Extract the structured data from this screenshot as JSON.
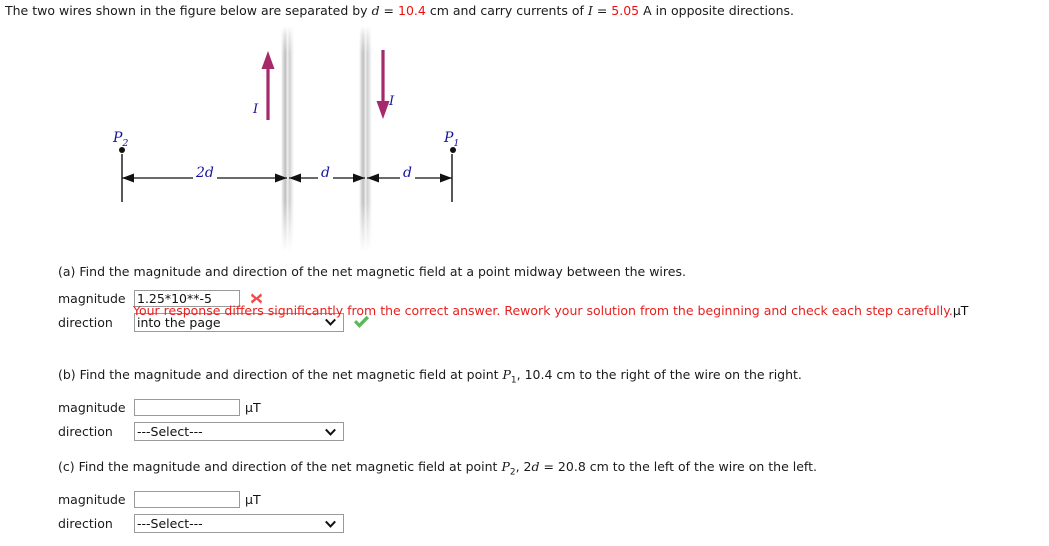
{
  "problem": {
    "intro_pre": "The two wires shown in the figure below are separated by ",
    "intro_d_sym": "d",
    "intro_eq1": " = ",
    "intro_d_value": "10.4",
    "intro_mid": " cm and carry currents of ",
    "intro_i_sym": "I",
    "intro_eq2": " = ",
    "intro_i_value": "5.05",
    "intro_post": " A in opposite directions."
  },
  "figure": {
    "current_label_left": "I",
    "current_label_right": "I",
    "point_left_label": "P",
    "point_left_sub": "2",
    "point_right_label": "P",
    "point_right_sub": "1",
    "dim_label_left": "2d",
    "dim_label_middle": "d",
    "dim_label_right": "d",
    "arrow_color": "#a6296b",
    "label_color": "#15139c"
  },
  "parts": {
    "a": {
      "prompt_prefix": "(a) Find the magnitude and direction of the net magnetic field at a point midway between the wires.",
      "magnitude_label": "magnitude",
      "magnitude_value": "1.25*10**-5",
      "magnitude_placeholder": "",
      "magnitude_mark": "incorrect-x",
      "feedback_text": "Your response differs significantly from the correct answer. Rework your solution from the beginning and check each step carefully.",
      "feedback_unit": "µT",
      "direction_label": "direction",
      "direction_value": "into the page",
      "direction_mark": "correct-check"
    },
    "b": {
      "prompt_a": "(b) Find the magnitude and direction of the net magnetic field at point ",
      "prompt_sym": "P",
      "prompt_sub": "1",
      "prompt_b": ", 10.4 cm to the right of the wire on the right.",
      "magnitude_label": "magnitude",
      "magnitude_value": "",
      "magnitude_unit": "µT",
      "direction_label": "direction",
      "direction_value": "---Select---"
    },
    "c": {
      "prompt_a": "(c) Find the magnitude and direction of the net magnetic field at point ",
      "prompt_sym": "P",
      "prompt_sub": "2",
      "prompt_mid": ", 2",
      "prompt_d": "d",
      "prompt_b": " = 20.8 cm to the left of the wire on the left.",
      "magnitude_label": "magnitude",
      "magnitude_value": "",
      "magnitude_unit": "µT",
      "direction_label": "direction",
      "direction_value": "---Select---"
    }
  },
  "colors": {
    "error_red": "#e8201f",
    "value_red": "#ee1111",
    "check_green": "#5cb85c",
    "x_red": "#f04c4c"
  }
}
